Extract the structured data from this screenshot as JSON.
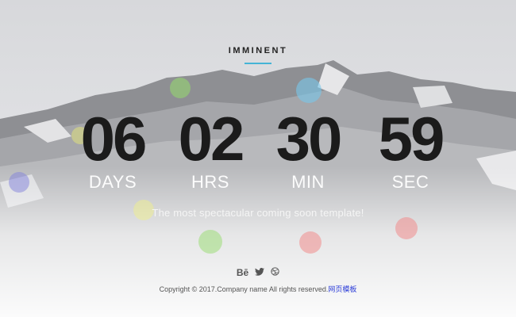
{
  "brand": {
    "name": "IMMINENT"
  },
  "countdown": [
    {
      "value": "06",
      "label": "DAYS"
    },
    {
      "value": "02",
      "label": "HRS"
    },
    {
      "value": "30",
      "label": "MIN"
    },
    {
      "value": "59",
      "label": "SEC"
    }
  ],
  "tagline": "The most spectacular coming soon template!",
  "social": {
    "items": [
      {
        "icon": "behance-icon",
        "glyph": "Bē"
      },
      {
        "icon": "twitter-icon",
        "glyph": ""
      },
      {
        "icon": "dribbble-icon",
        "glyph": ""
      }
    ]
  },
  "footer": {
    "copyright": "Copyright © 2017.Company name All rights reserved.",
    "link": "网页模板"
  },
  "colors": {
    "accent": "#45b4d6",
    "number": "#1b1b1b",
    "link": "#2a3bd8"
  }
}
